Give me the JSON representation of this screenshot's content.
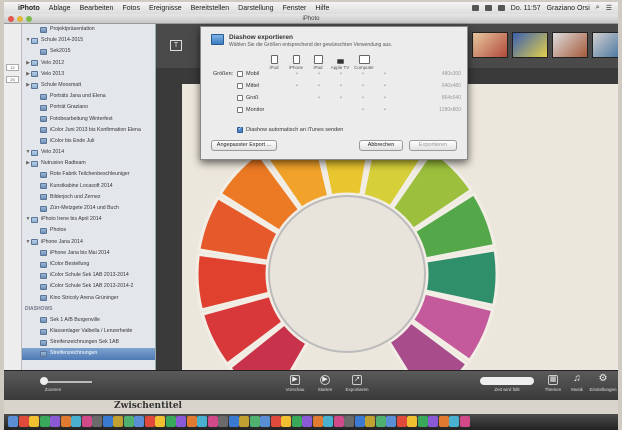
{
  "menubar": {
    "app": "iPhoto",
    "items": [
      "Ablage",
      "Bearbeiten",
      "Fotos",
      "Ereignisse",
      "Bereitstellen",
      "Darstellung",
      "Fenster",
      "Hilfe"
    ],
    "datetime": "Do. 11:57",
    "user": "Graziano Orsi"
  },
  "window": {
    "title": "iPhoto"
  },
  "leftstrip": {
    "a": "12",
    "b": "25"
  },
  "sidebar": {
    "items": [
      {
        "label": "Projektpräsentation",
        "tri": "",
        "hdr": false
      },
      {
        "label": "Schule 2014-2015",
        "tri": "▼",
        "hdr": false
      },
      {
        "label": "Sek2015",
        "tri": "",
        "hdr": false
      },
      {
        "label": "Velo 2012",
        "tri": "▶",
        "hdr": false
      },
      {
        "label": "Velo 2013",
        "tri": "▶",
        "hdr": false
      },
      {
        "label": "Schule Moosmatt",
        "tri": "▶",
        "hdr": false
      },
      {
        "label": "Porträts Jana und Elena",
        "tri": "",
        "hdr": false
      },
      {
        "label": "Porträt Graziano",
        "tri": "",
        "hdr": false
      },
      {
        "label": "Fotobearbeitung Winterfest",
        "tri": "",
        "hdr": false
      },
      {
        "label": "iColor Juni 2013 bis Konfirmation Elena",
        "tri": "",
        "hdr": false
      },
      {
        "label": "iColor bis Ende Juli",
        "tri": "",
        "hdr": false
      },
      {
        "label": "Velo 2014",
        "tri": "▼",
        "hdr": false
      },
      {
        "label": "Nutrusion Radteam",
        "tri": "▶",
        "hdr": false
      },
      {
        "label": "Rote Fabrik Teilchenbeschleuniger",
        "tri": "",
        "hdr": false
      },
      {
        "label": "Kunstkabine Locasoft 2014",
        "tri": "",
        "hdr": false
      },
      {
        "label": "Bilderjoch und Zernez",
        "tri": "",
        "hdr": false
      },
      {
        "label": "Zürr-Metzgete 2014 und Buch",
        "tri": "",
        "hdr": false
      },
      {
        "label": "iPhoto Irene bis April 2014",
        "tri": "▼",
        "hdr": false
      },
      {
        "label": "Photos",
        "tri": "",
        "hdr": false
      },
      {
        "label": "iPhone Jana 2014",
        "tri": "▼",
        "hdr": false
      },
      {
        "label": "iPhone Jana bis Mai 2014",
        "tri": "",
        "hdr": false
      },
      {
        "label": "iColor Bestellung",
        "tri": "",
        "hdr": false
      },
      {
        "label": "iColor Schule Sek 1AB 2013-2014",
        "tri": "",
        "hdr": false
      },
      {
        "label": "iColor Schule Sek 1AB 2013-2014-2",
        "tri": "",
        "hdr": false
      },
      {
        "label": "Kino Stricoly Arena Grüninger",
        "tri": "",
        "hdr": false
      },
      {
        "label": "DIASHOWS",
        "tri": "",
        "hdr": true
      },
      {
        "label": "Sek 1 A/B Burgenville",
        "tri": "",
        "hdr": false
      },
      {
        "label": "Klassenlager Valbella / Lenzerheide",
        "tri": "",
        "hdr": false
      },
      {
        "label": "Streifenzeichnungen Sek 1AB",
        "tri": "",
        "hdr": false
      },
      {
        "label": "Streifenzeichnungen",
        "tri": "",
        "hdr": false,
        "sel": true
      }
    ]
  },
  "dialog": {
    "title": "Diashow exportieren",
    "subtitle": "Wählen Sie die Größen entsprechend der gewünschten Verwendung aus.",
    "devices": [
      "iPod",
      "iPhone",
      "iPad",
      "Apple TV",
      "Computer"
    ],
    "sizes_label": "Größen:",
    "sizes": [
      {
        "label": "Mobil",
        "res": "480x300",
        "checked": false
      },
      {
        "label": "Mittel",
        "res": "640x480",
        "checked": false
      },
      {
        "label": "Groß",
        "res": "864x540",
        "checked": false
      },
      {
        "label": "Monitor",
        "res": "1280x800",
        "checked": false
      }
    ],
    "itunes_label": "Diashow automatisch an iTunes senden",
    "custom_export": "Angepasster Export ...",
    "cancel": "Abbrechen",
    "export": "Exportieren"
  },
  "toolbar": {
    "zoom_label": "Zoomen",
    "preview": "Vorschau",
    "play": "Starten",
    "settings": "Exportieren",
    "themes": "Themen",
    "music": "Musik",
    "prefs": "Einstellungen",
    "duration": "Zeit wird füllt"
  },
  "document": {
    "heading": "Zwischentitel"
  }
}
